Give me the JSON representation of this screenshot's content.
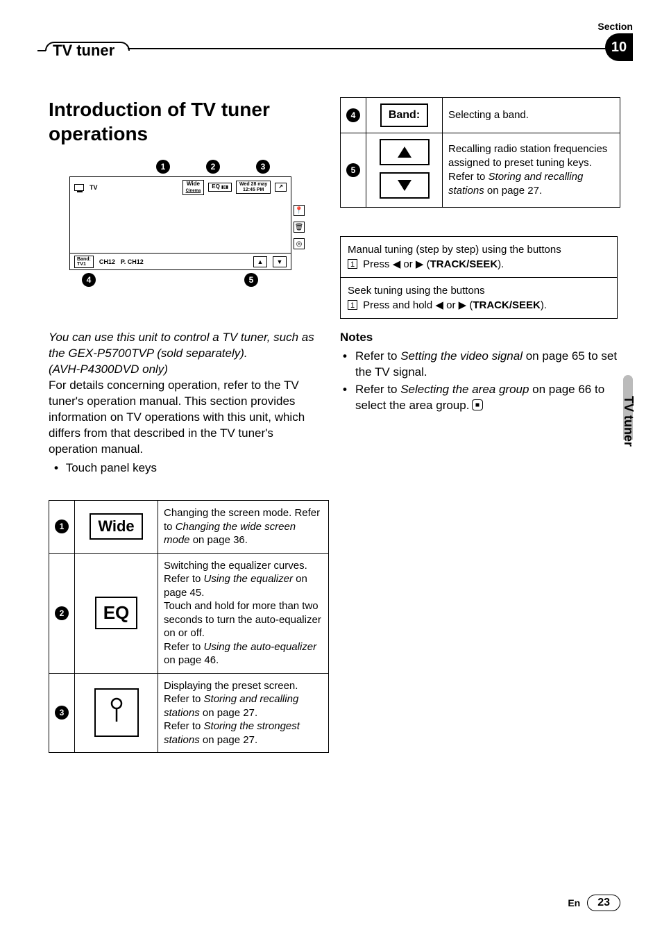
{
  "section_label": "Section",
  "section_number": "10",
  "header_title": "TV tuner",
  "side_label": "TV tuner",
  "heading": "Introduction of TV tuner operations",
  "diagram": {
    "callouts_top": [
      "1",
      "2",
      "3"
    ],
    "callouts_bottom": [
      "4",
      "5"
    ],
    "tv_label": "TV",
    "wide_label": "Wide",
    "wide_sub": "Cinema",
    "eq_label": "EQ",
    "date_line1": "Wed 28 may",
    "date_line2": "12:45 PM",
    "band_btn_top": "Band:",
    "band_btn_val": "TV1",
    "ch_text": "CH12",
    "p_text": "P. CH12"
  },
  "intro_italic_1": "You can use this unit to control a TV tuner, such as the GEX-P5700TVP (sold separately).",
  "intro_italic_2": "(AVH-P4300DVD only)",
  "intro_plain": "For details concerning operation, refer to the TV tuner's operation manual. This section provides information on TV operations with this unit, which differs from that described in the TV tuner's operation manual.",
  "intro_bullet": "Touch panel keys",
  "left_table": [
    {
      "num": "1",
      "key_type": "wide",
      "key_label": "Wide",
      "desc_pre": "Changing the screen mode. Refer to ",
      "desc_em": "Changing the wide screen mode",
      "desc_post": " on page 36."
    },
    {
      "num": "2",
      "key_type": "eq",
      "key_label": "EQ",
      "desc_pre": "Switching the equalizer curves.\nRefer to ",
      "desc_em": "Using the equalizer",
      "desc_post": " on page 45.\nTouch and hold for more than two seconds to turn the auto-equalizer on or off.\nRefer to ",
      "desc_em2": "Using the auto-equalizer",
      "desc_post2": " on page 46."
    },
    {
      "num": "3",
      "key_type": "pin",
      "key_label": "",
      "desc_pre": "Displaying the preset screen.\nRefer to ",
      "desc_em": "Storing and recalling stations",
      "desc_post": " on page 27.\nRefer to ",
      "desc_em2": "Storing the strongest stations",
      "desc_post2": " on page 27."
    }
  ],
  "right_table": [
    {
      "num": "4",
      "key_type": "band",
      "key_label": "Band:",
      "desc_pre": "Selecting a band.",
      "desc_em": "",
      "desc_post": ""
    },
    {
      "num": "5",
      "key_type": "updown",
      "key_label": "",
      "desc_pre": "Recalling radio station frequencies assigned to preset tuning keys.\nRefer to ",
      "desc_em": "Storing and recalling stations",
      "desc_post": " on page 27."
    }
  ],
  "tuning": {
    "box1_line1": "Manual tuning (step by step) using the buttons",
    "box1_step": "1",
    "box1_line2a": "Press ",
    "box1_line2b": " or ",
    "box1_line2c": " (",
    "box1_strong": "TRACK/SEEK",
    "box1_line2d": ").",
    "box2_line1": "Seek tuning using the buttons",
    "box2_step": "1",
    "box2_line2a": "Press and hold ",
    "box2_line2b": " or ",
    "box2_line2c": " (",
    "box2_strong": "TRACK/SEEK",
    "box2_line2d": ")."
  },
  "notes": {
    "heading": "Notes",
    "items": [
      {
        "pre": "Refer to ",
        "em": "Setting the video signal",
        "post": " on page 65 to set the TV signal."
      },
      {
        "pre": "Refer to ",
        "em": "Selecting the area group",
        "post": " on page 66 to select the area group."
      }
    ]
  },
  "footer_lang": "En",
  "footer_page": "23"
}
